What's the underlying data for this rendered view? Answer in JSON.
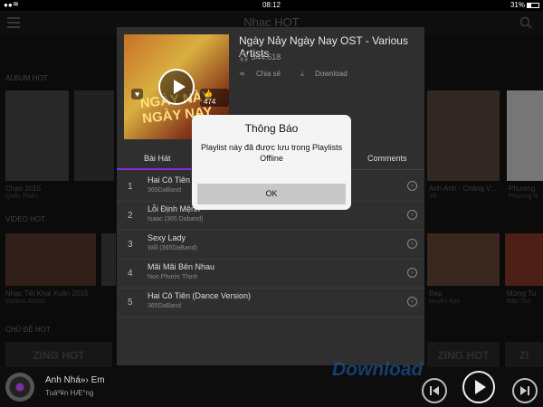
{
  "status": {
    "time": "08:12",
    "battery": "31%"
  },
  "app": {
    "title": "Nhạc HOT"
  },
  "sections": {
    "album_hot": "ALBUM HOT",
    "video_hot": "VIDEO HOT",
    "chu_de_hot": "CHỦ ĐỀ HOT"
  },
  "background_tiles": {
    "album_row": [
      {
        "caption": "Chao 2015",
        "sub": "Quốc Thiên"
      },
      {
        "caption": "Anh Anh - Chàng V...",
        "sub": "Về"
      },
      {
        "caption": "Phương",
        "sub": "Phương N"
      }
    ],
    "video_row": [
      {
        "caption": "Nhạc Tết Khai Xuân 2015",
        "sub": "Various Artists"
      },
      {
        "caption": "Đẹp",
        "sub": "Huyền Kim"
      },
      {
        "caption": "Mừng Tu",
        "sub": "Đào Trư"
      }
    ],
    "banners": [
      "ZING HOT",
      "ZING NEW",
      "ZING HOT",
      "ZI"
    ]
  },
  "album": {
    "cover_text": "NGÀY NÀY NGÀY NAY",
    "title": "Ngày Nảy Ngày Nay OST - Various Artists",
    "listens": "344.618",
    "likes": "474",
    "share_label": "Chia sẻ",
    "download_label": "Download"
  },
  "tabs": [
    {
      "label": "Bài Hát"
    },
    {
      "label": "Comments"
    }
  ],
  "tracks": [
    {
      "num": "1",
      "name": "Hai Cô Tiên",
      "artist": "365DaBand"
    },
    {
      "num": "2",
      "name": "Lỗi Định Mệnh",
      "artist": "Isaac (365 Daband)"
    },
    {
      "num": "3",
      "name": "Sexy Lady",
      "artist": "Will (365DaBand)"
    },
    {
      "num": "4",
      "name": "Mãi Mãi Bên Nhau",
      "artist": "Noo Phước Thịnh"
    },
    {
      "num": "5",
      "name": "Hai Cô Tiên (Dance Version)",
      "artist": "365DaBand"
    }
  ],
  "dialog": {
    "title": "Thông Báo",
    "message": "Playlist này đã được lưu trong Playlists Offline",
    "ok": "OK"
  },
  "player": {
    "title": "Anh Nhá»› Em",
    "artist": "Tuáº¥n HÆ°ng"
  },
  "watermark": "Download",
  "icons": {
    "menu": "menu-icon",
    "search": "search-icon",
    "headphones": "headphones-icon",
    "share": "share-icon",
    "download": "download-icon",
    "heart": "heart-icon",
    "like": "thumbs-up-icon",
    "play": "play-icon",
    "prev": "previous-icon",
    "next": "next-icon"
  },
  "colors": {
    "accent": "#8a2be2",
    "panel": "#2f2f2f",
    "dialog": "#f4f4f4"
  }
}
